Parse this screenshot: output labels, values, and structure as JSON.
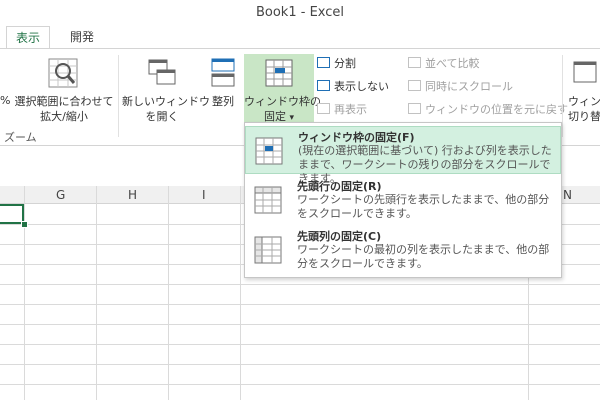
{
  "window": {
    "title": "Book1 - Excel"
  },
  "tabs": [
    {
      "label": "表示",
      "active": true
    },
    {
      "label": "開発",
      "active": false
    }
  ],
  "ribbon": {
    "partial_left_label": "%",
    "zoom_to_selection_line1": "選択範囲に合わせて",
    "zoom_to_selection_line2": "拡大/縮小",
    "zoom_group_label": "ズーム",
    "new_window_line1": "新しいウィンドウ",
    "new_window_line2": "を開く",
    "arrange_all": "整列",
    "freeze_panes_line1": "ウィンドウ枠の",
    "freeze_panes_line2": "固定",
    "freeze_dropdown_arrow": "▾",
    "split": "分割",
    "hide": "表示しない",
    "unhide": "再表示",
    "view_side_by_side": "並べて比較",
    "sync_scroll": "同時にスクロール",
    "reset_window_pos": "ウィンドウの位置を元に戻す",
    "switch_windows_line1": "ウィン",
    "switch_windows_line2": "切り替"
  },
  "sheet": {
    "columns": [
      "G",
      "H",
      "I",
      "N"
    ]
  },
  "freeze_menu": {
    "items": [
      {
        "title": "ウィンドウ枠の固定(F)",
        "desc": "(現在の選択範囲に基づいて) 行および列を表示したままで、ワークシートの残りの部分をスクロールできます。"
      },
      {
        "title": "先頭行の固定(R)",
        "desc": "ワークシートの先頭行を表示したままで、他の部分をスクロールできます。"
      },
      {
        "title": "先頭列の固定(C)",
        "desc": "ワークシートの最初の列を表示したままで、他の部分をスクロールできます。"
      }
    ]
  },
  "colors": {
    "accent": "#217346",
    "menu_highlight": "#d3f0e0",
    "button_pressed": "#c9e6c6"
  }
}
